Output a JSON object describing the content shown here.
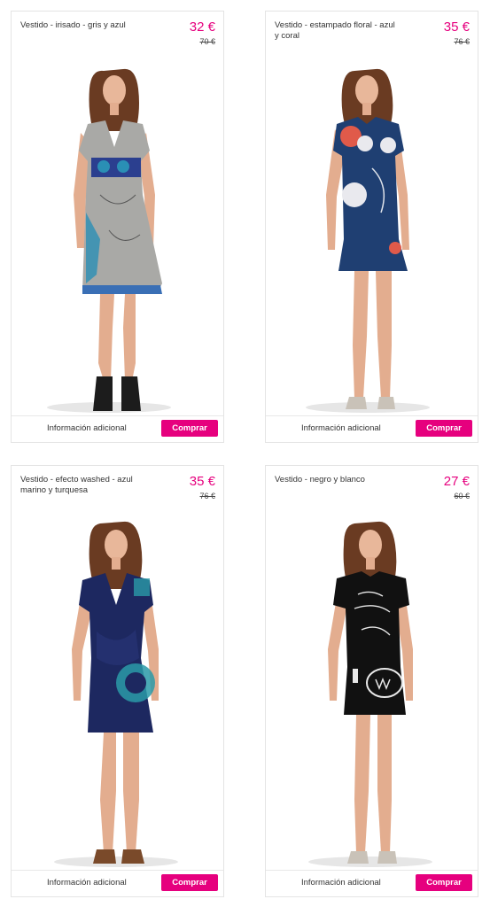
{
  "colors": {
    "accent": "#e6007e",
    "border": "#e4e4e4"
  },
  "products": [
    {
      "title": "Vestido - irisado - gris y azul",
      "price": "32 €",
      "old_price": "70 €",
      "info_label": "Información adicional",
      "buy_label": "Comprar",
      "image_alt": "Model wearing grey iridescent dress with blue print"
    },
    {
      "title": "Vestido - estampado floral - azul y coral",
      "price": "35 €",
      "old_price": "76 €",
      "info_label": "Información adicional",
      "buy_label": "Comprar",
      "image_alt": "Model wearing navy dress with coral floral print"
    },
    {
      "title": "Vestido - efecto washed - azul marino y turquesa",
      "price": "35 €",
      "old_price": "76 €",
      "info_label": "Información adicional",
      "buy_label": "Comprar",
      "image_alt": "Model wearing navy wrap dress with turquoise mandala"
    },
    {
      "title": "Vestido - negro y blanco",
      "price": "27 €",
      "old_price": "60 €",
      "info_label": "Información adicional",
      "buy_label": "Comprar",
      "image_alt": "Model wearing black t-shirt dress with white print"
    }
  ]
}
